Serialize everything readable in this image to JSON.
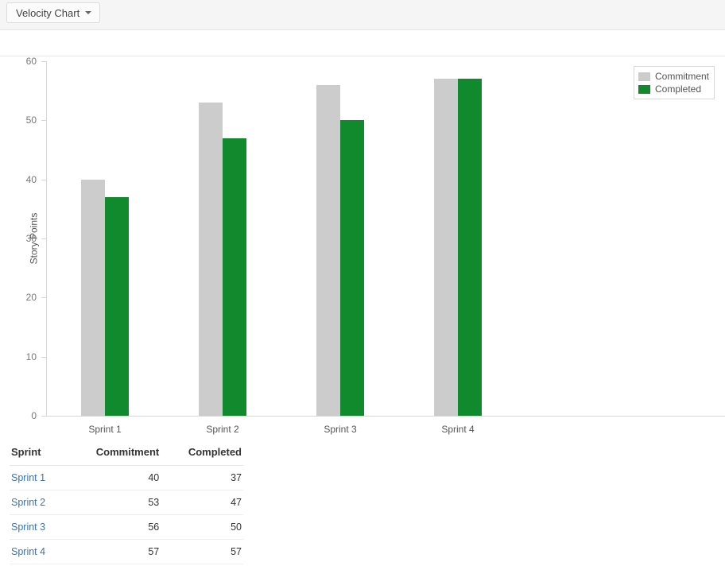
{
  "toolbar": {
    "chart_type_label": "Velocity Chart",
    "caret_icon": "chevron-down-icon"
  },
  "chart_data": {
    "type": "bar",
    "title": "",
    "xlabel": "",
    "ylabel": "Story Points",
    "categories": [
      "Sprint 1",
      "Sprint 2",
      "Sprint 3",
      "Sprint 4"
    ],
    "series": [
      {
        "name": "Commitment",
        "color": "#cccccc",
        "values": [
          40,
          53,
          56,
          57
        ]
      },
      {
        "name": "Completed",
        "color": "#118a2e",
        "values": [
          37,
          47,
          50,
          57
        ]
      }
    ],
    "ylim": [
      0,
      60
    ],
    "yticks": [
      0,
      10,
      20,
      30,
      40,
      50,
      60
    ],
    "ytick_labels": [
      "0",
      "10",
      "20",
      "30",
      "40",
      "50",
      "60"
    ],
    "grid": false,
    "legend_position": "top-right"
  },
  "legend": {
    "items": [
      {
        "label": "Commitment",
        "color": "#cccccc"
      },
      {
        "label": "Completed",
        "color": "#118a2e"
      }
    ]
  },
  "table": {
    "columns": [
      "Sprint",
      "Commitment",
      "Completed"
    ],
    "rows": [
      {
        "sprint": "Sprint 1",
        "commitment": "40",
        "completed": "37"
      },
      {
        "sprint": "Sprint 2",
        "commitment": "53",
        "completed": "47"
      },
      {
        "sprint": "Sprint 3",
        "commitment": "56",
        "completed": "50"
      },
      {
        "sprint": "Sprint 4",
        "commitment": "57",
        "completed": "57"
      }
    ]
  }
}
